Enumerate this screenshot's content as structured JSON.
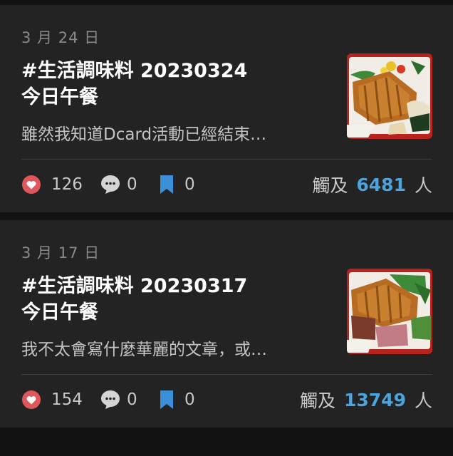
{
  "colors": {
    "background": "#121212",
    "card": "#232323",
    "accent": "#4da3de",
    "like": "#e0575b",
    "save": "#3b8fd9"
  },
  "posts": [
    {
      "date": "3 月 24 日",
      "title_line1": "#生活調味料 20230324",
      "title_line2": "今日午餐",
      "excerpt": "雖然我知道Dcard活動已經結束…",
      "likes": "126",
      "comments": "0",
      "saves": "0",
      "reach_label": "觸及",
      "reach_count": "6481",
      "reach_unit": "人",
      "icons": [
        "heart-icon",
        "comment-bubble-icon",
        "bookmark-icon"
      ]
    },
    {
      "date": "3 月 17 日",
      "title_line1": "#生活調味料 20230317",
      "title_line2": "今日午餐",
      "excerpt": "我不太會寫什麼華麗的文章，或…",
      "likes": "154",
      "comments": "0",
      "saves": "0",
      "reach_label": "觸及",
      "reach_count": "13749",
      "reach_unit": "人",
      "icons": [
        "heart-icon",
        "comment-bubble-icon",
        "bookmark-icon"
      ]
    }
  ]
}
